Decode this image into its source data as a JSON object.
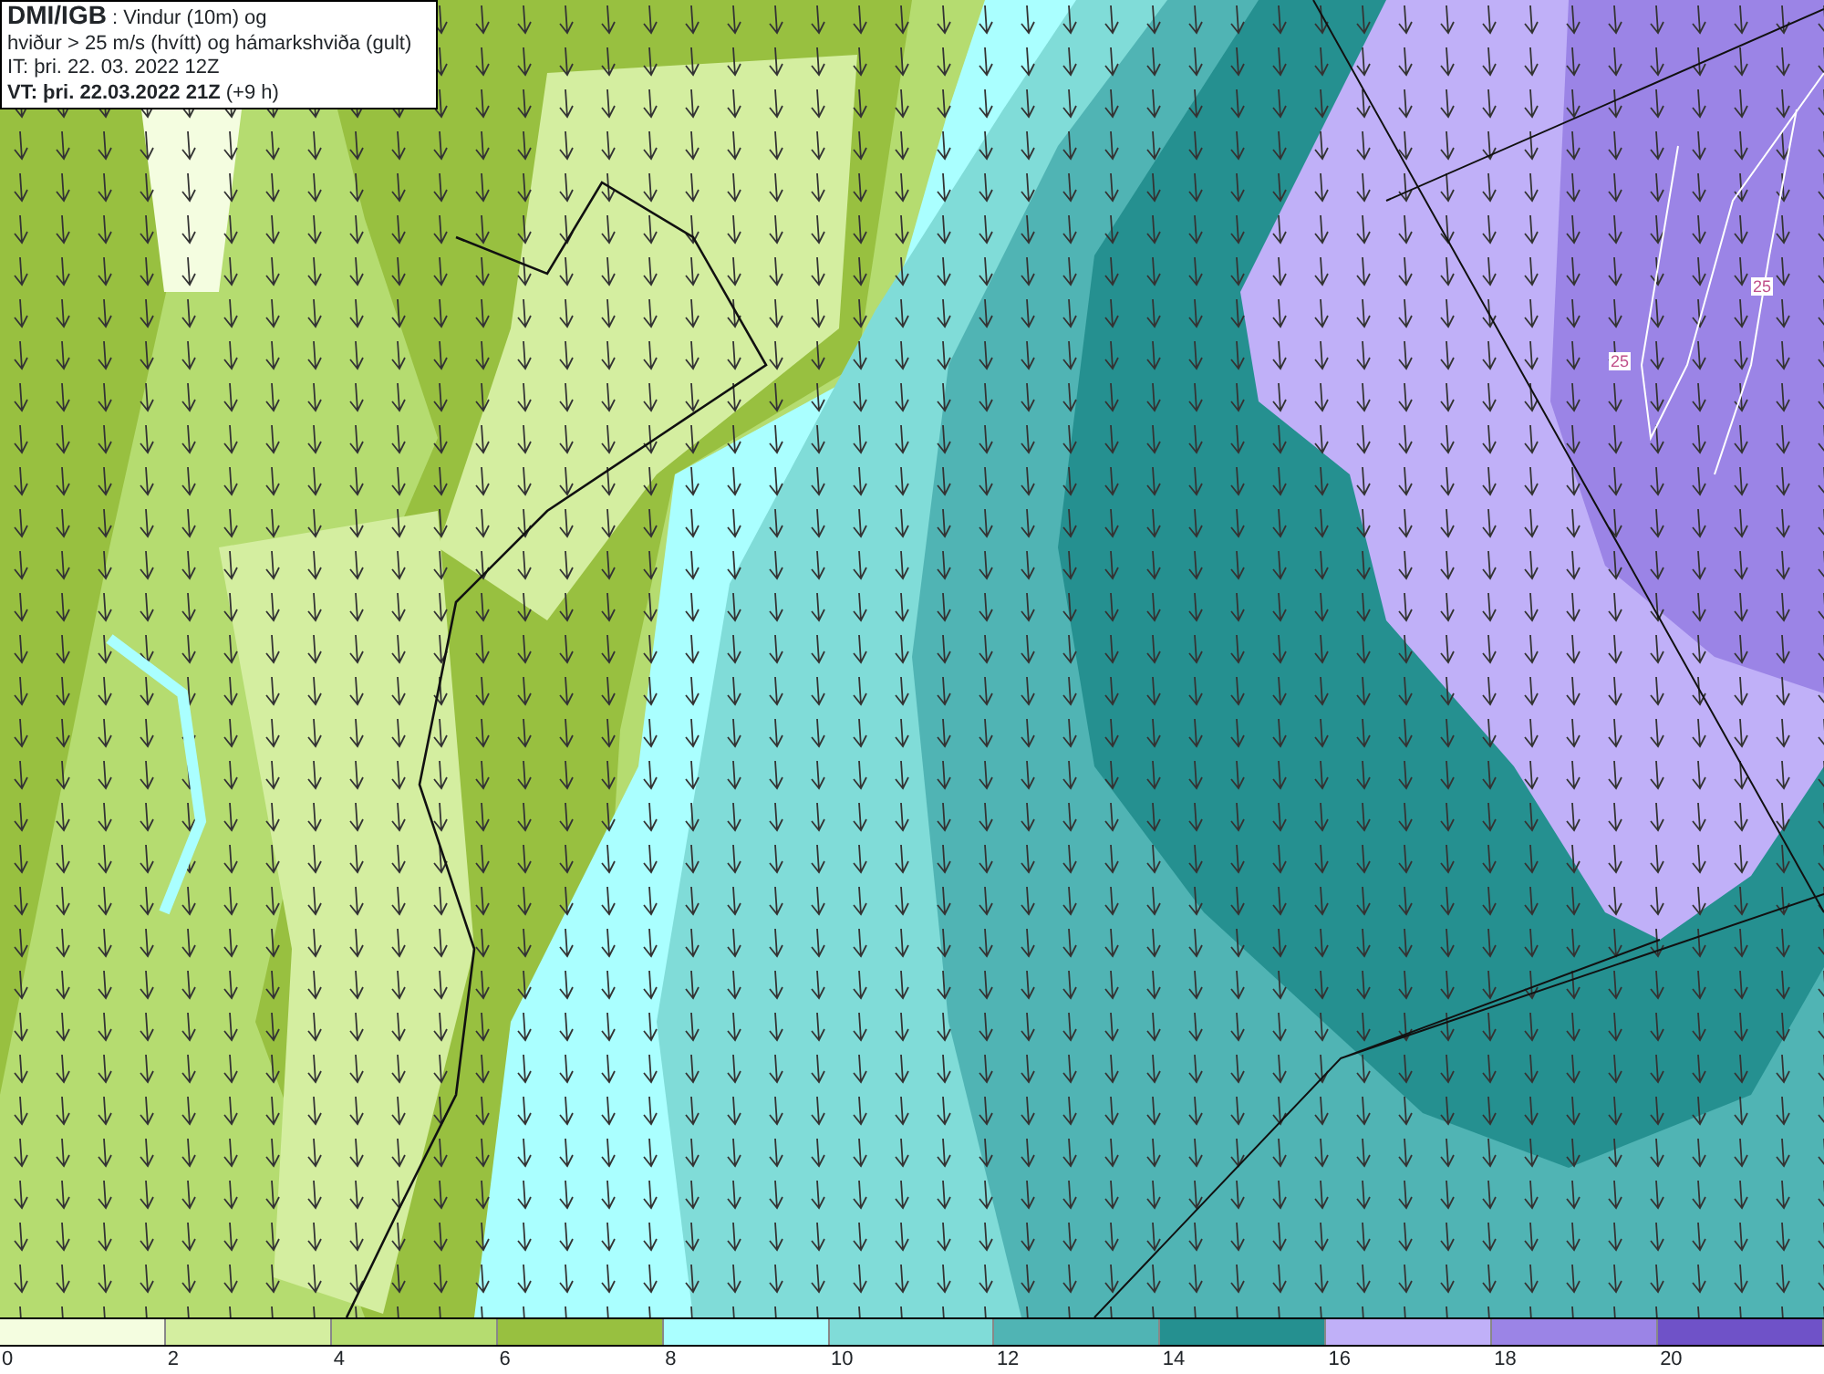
{
  "title_box": {
    "lines": [
      "**DMI/IGB** : Vindur (10m) og",
      "hviður > 25 m/s (hvítt) og hámarkshviða (gult)",
      "IT: þri. 22. 03. 2022 12Z",
      "**VT: þri. 22.03.2022 21Z** (+9 h)"
    ]
  },
  "map": {
    "contour_labels": [
      "25",
      "25"
    ]
  },
  "legend": {
    "bins": [
      {
        "color": "#f4fde0"
      },
      {
        "color": "#d4eea0"
      },
      {
        "color": "#b5dc70"
      },
      {
        "color": "#98c040"
      },
      {
        "color": "#aaffff"
      },
      {
        "color": "#80dcd8"
      },
      {
        "color": "#50b4b4"
      },
      {
        "color": "#259090"
      },
      {
        "color": "#c0b0f8"
      },
      {
        "color": "#9b84e6"
      },
      {
        "color": "#6f52c8"
      }
    ],
    "ticks": [
      "0",
      "2",
      "4",
      "6",
      "8",
      "10",
      "12",
      "14",
      "16",
      "18",
      "20"
    ]
  }
}
